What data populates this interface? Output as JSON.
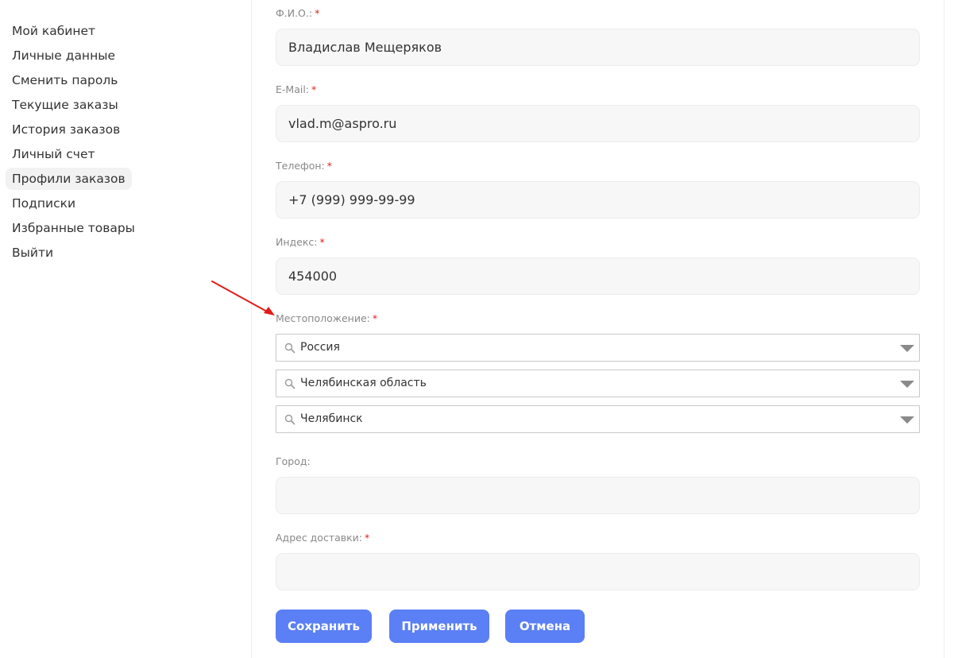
{
  "sidebar": {
    "items": [
      {
        "label": "Мой кабинет"
      },
      {
        "label": "Личные данные"
      },
      {
        "label": "Сменить пароль"
      },
      {
        "label": "Текущие заказы"
      },
      {
        "label": "История заказов"
      },
      {
        "label": "Личный счет"
      },
      {
        "label": "Профили заказов",
        "active": true
      },
      {
        "label": "Подписки"
      },
      {
        "label": "Избранные товары"
      },
      {
        "label": "Выйти"
      }
    ]
  },
  "form": {
    "required_mark": "*",
    "fio": {
      "label": "Ф.И.О.:",
      "value": "Владислав Мещеряков"
    },
    "email": {
      "label": "E-Mail:",
      "value": "vlad.m@aspro.ru"
    },
    "phone": {
      "label": "Телефон:",
      "value": "+7 (999) 999-99-99"
    },
    "index": {
      "label": "Индекс:",
      "value": "454000"
    },
    "location": {
      "label": "Местоположение:",
      "country": "Россия",
      "region": "Челябинская область",
      "city": "Челябинск"
    },
    "town": {
      "label": "Город:",
      "value": ""
    },
    "address": {
      "label": "Адрес доставки:",
      "value": ""
    }
  },
  "buttons": {
    "save": "Сохранить",
    "apply": "Применить",
    "cancel": "Отмена"
  },
  "colors": {
    "accent": "#5b7ff5",
    "required": "#e02020",
    "annotation_arrow": "#e31b1b"
  },
  "icons": {
    "select_search": "magnifier-icon",
    "select_toggle": "triangle-down-icon"
  }
}
